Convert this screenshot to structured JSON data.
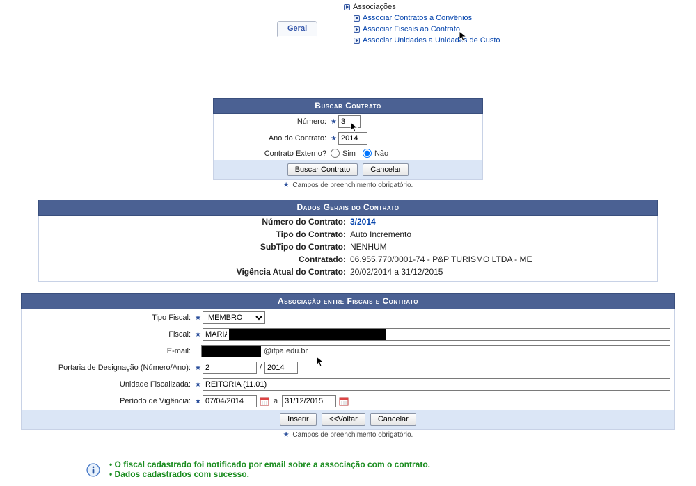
{
  "nav": {
    "parent": "Associações",
    "items": [
      "Associar Contratos a Convênios",
      "Associar Fiscais ao Contrato",
      "Associar Unidades a Unidades de Custo"
    ]
  },
  "tab_geral": "Geral",
  "search": {
    "title": "Buscar Contrato",
    "numero_label": "Número:",
    "numero_value": "3",
    "ano_label": "Ano do Contrato:",
    "ano_value": "2014",
    "externo_label": "Contrato Externo?",
    "sim": "Sim",
    "nao": "Não",
    "buscar_btn": "Buscar Contrato",
    "cancelar_btn": "Cancelar",
    "mand_hint": "Campos de preenchimento obrigatório."
  },
  "dados": {
    "title": "Dados Gerais do Contrato",
    "numero_k": "Número do Contrato:",
    "numero_v": "3/2014",
    "tipo_k": "Tipo do Contrato:",
    "tipo_v": "Auto Incremento",
    "subtipo_k": "SubTipo do Contrato:",
    "subtipo_v": "NENHUM",
    "contratado_k": "Contratado:",
    "contratado_v": "06.955.770/0001-74 - P&P TURISMO LTDA - ME",
    "vigencia_k": "Vigência Atual do Contrato:",
    "vigencia_v": "20/02/2014 a 31/12/2015"
  },
  "assoc": {
    "title": "Associação entre Fiscais e Contrato",
    "tipo_fiscal_label": "Tipo Fiscal:",
    "tipo_fiscal_value": "MEMBRO",
    "fiscal_label": "Fiscal:",
    "fiscal_value": "MARIA",
    "email_label": "E-mail:",
    "email_domain": "@ifpa.edu.br",
    "portaria_label": "Portaria de Designação (Número/Ano):",
    "portaria_num": "2",
    "portaria_ano": "2014",
    "unidade_label": "Unidade Fiscalizada:",
    "unidade_value": "REITORIA (11.01)",
    "periodo_label": "Período de Vigência:",
    "periodo_ini": "07/04/2014",
    "periodo_fim": "31/12/2015",
    "a": "a",
    "inserir_btn": "Inserir",
    "voltar_btn": "<<Voltar",
    "cancelar_btn": "Cancelar",
    "mand_hint": "Campos de preenchimento obrigatório."
  },
  "info": {
    "line1": "O fiscal cadastrado foi notificado por email sobre a associação com o contrato.",
    "line2": "Dados cadastrados com sucesso."
  }
}
